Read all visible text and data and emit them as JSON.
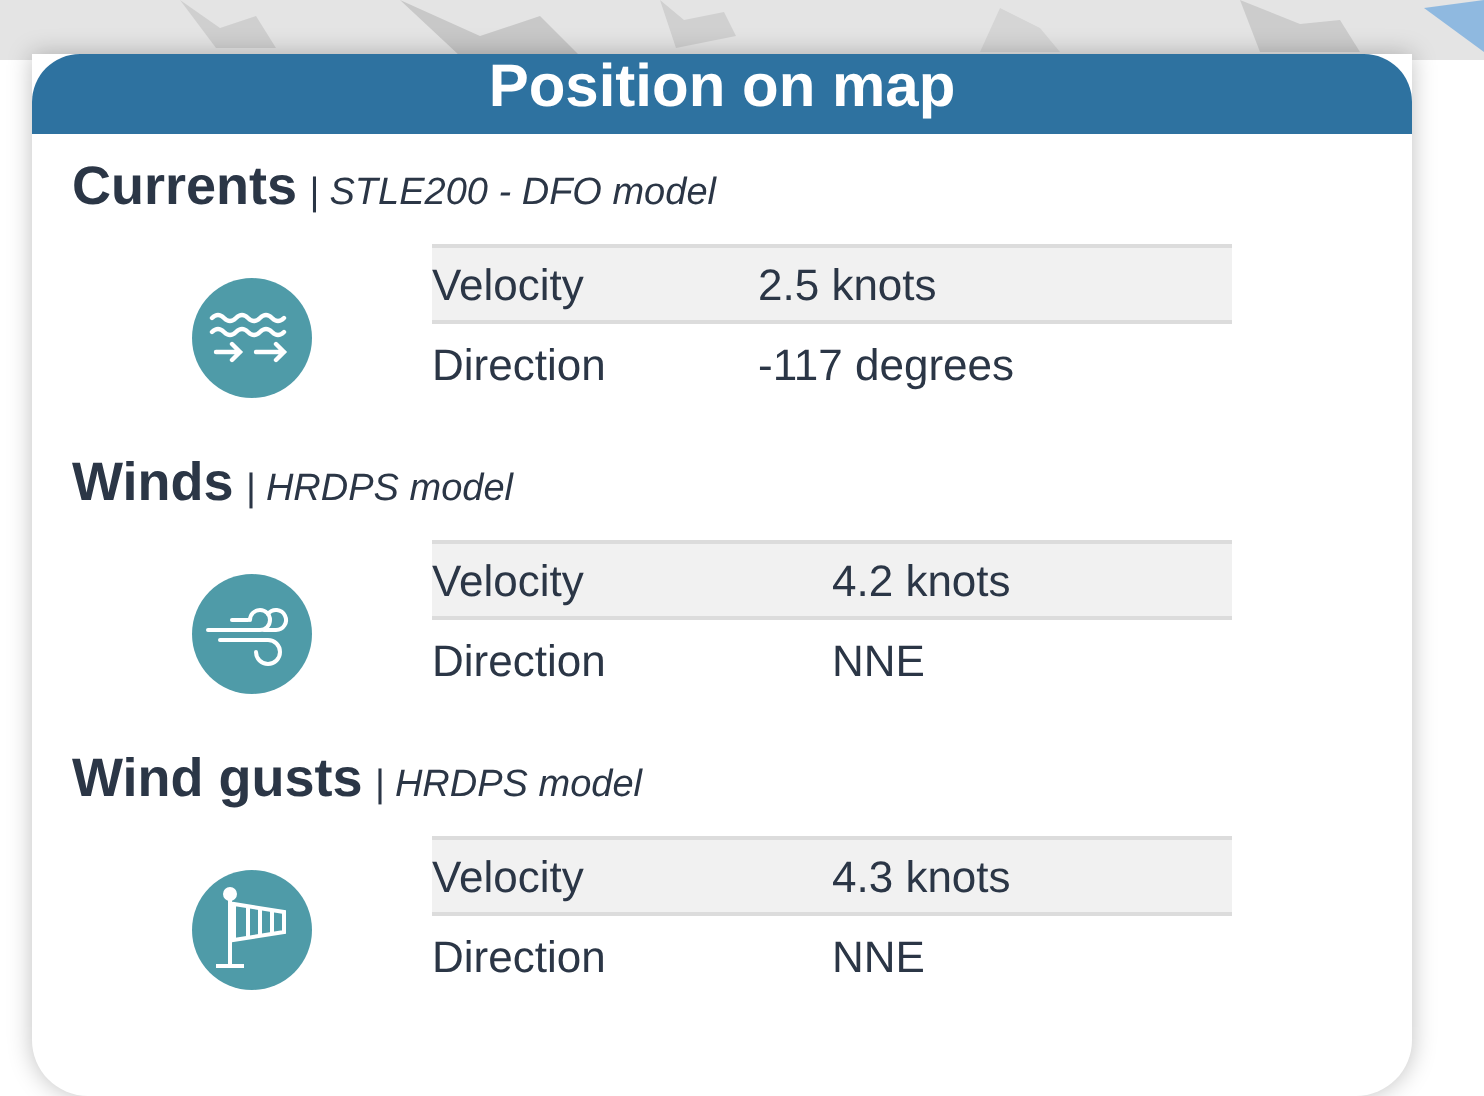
{
  "panel": {
    "title": "Position on map"
  },
  "sections": [
    {
      "kind": "current",
      "title": "Currents",
      "model": "| STLE200 - DFO model",
      "rows": [
        {
          "label": "Velocity",
          "value": "2.5 knots"
        },
        {
          "label": "Direction",
          "value": "-117 degrees"
        }
      ]
    },
    {
      "kind": "wind",
      "title": "Winds",
      "model": "| HRDPS model",
      "rows": [
        {
          "label": "Velocity",
          "value": "4.2 knots"
        },
        {
          "label": "Direction",
          "value": "NNE"
        }
      ]
    },
    {
      "kind": "gust",
      "title": "Wind gusts",
      "model": "| HRDPS model",
      "rows": [
        {
          "label": "Velocity",
          "value": "4.3 knots"
        },
        {
          "label": "Direction",
          "value": "NNE"
        }
      ]
    }
  ]
}
